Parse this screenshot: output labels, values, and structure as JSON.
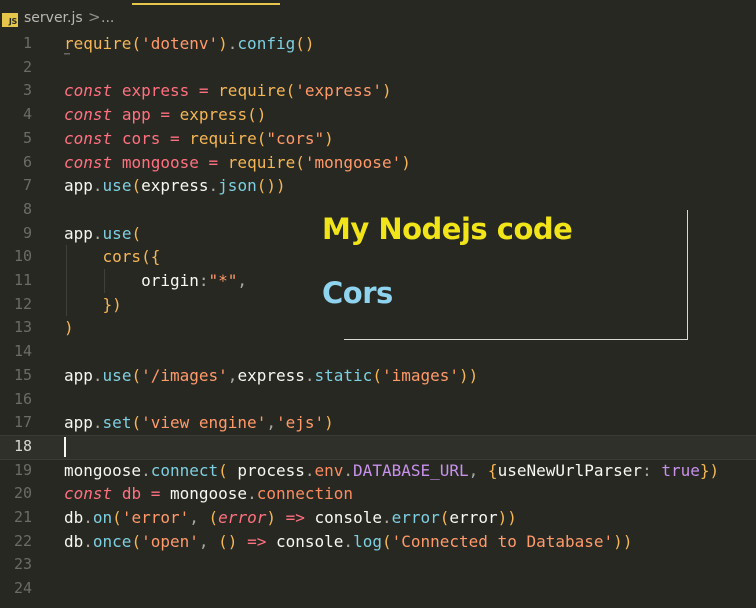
{
  "breadcrumb": {
    "icon": "js-file-icon",
    "icon_text": "JS",
    "file": "server.js",
    "separator": ">",
    "more": "..."
  },
  "editor": {
    "active_line": 18,
    "line_numbers": [
      "1",
      "2",
      "3",
      "4",
      "5",
      "6",
      "7",
      "8",
      "9",
      "10",
      "11",
      "12",
      "13",
      "14",
      "15",
      "16",
      "17",
      "18",
      "19",
      "20",
      "21",
      "22",
      "23",
      "24"
    ],
    "lines": [
      "require('dotenv').config()",
      "",
      "const express = require('express')",
      "const app = express()",
      "const cors = require(\"cors\")",
      "const mongoose = require('mongoose')",
      "app.use(express.json())",
      "",
      "app.use(",
      "    cors({",
      "        origin:\"*\",",
      "    })",
      ")",
      "",
      "app.use('/images',express.static('images'))",
      "",
      "app.set('view engine','ejs')",
      "",
      "mongoose.connect( process.env.DATABASE_URL, {useNewUrlParser: true})",
      "const db = mongoose.connection",
      "db.on('error', (error) => console.error(error))",
      "db.once('open', () => console.log('Connected to Database'))",
      "",
      ""
    ]
  },
  "overlay": {
    "title": "My Nodejs code",
    "subtitle": "Cors",
    "title_color": "#f1e519",
    "subtitle_color": "#8fd3ee"
  },
  "colors": {
    "background": "#272822",
    "accent": "#e6c64a"
  }
}
